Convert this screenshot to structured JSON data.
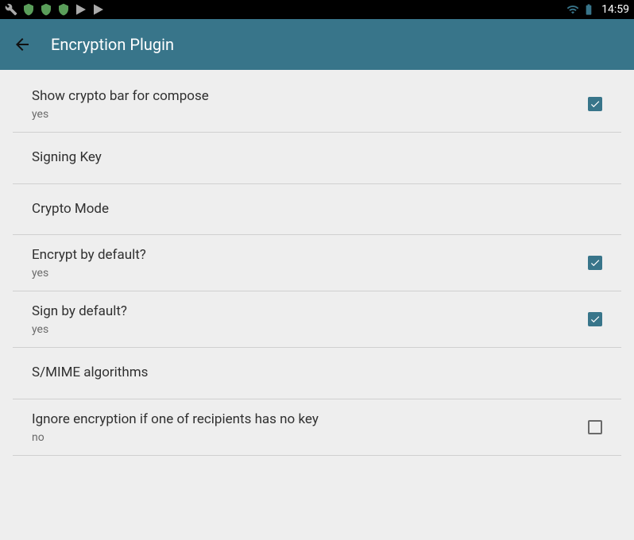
{
  "status_bar": {
    "time": "14:59"
  },
  "app_bar": {
    "title": "Encryption Plugin"
  },
  "settings": {
    "show_crypto_bar": {
      "title": "Show crypto bar for compose",
      "value": "yes",
      "checked": true
    },
    "signing_key": {
      "title": "Signing Key"
    },
    "crypto_mode": {
      "title": "Crypto Mode"
    },
    "encrypt_default": {
      "title": "Encrypt by default?",
      "value": "yes",
      "checked": true
    },
    "sign_default": {
      "title": "Sign by default?",
      "value": "yes",
      "checked": true
    },
    "smime_algorithms": {
      "title": "S/MIME algorithms"
    },
    "ignore_encryption": {
      "title": "Ignore encryption if one of recipients has no key",
      "value": "no",
      "checked": false
    }
  }
}
